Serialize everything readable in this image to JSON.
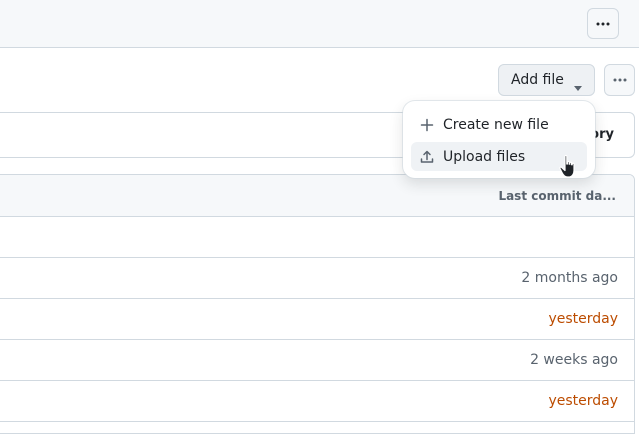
{
  "toolbar": {
    "more_icon": "kebab-horizontal-icon"
  },
  "file_actions": {
    "add_file_label": "Add file",
    "add_file_icon": "triangle-down-icon",
    "more_icon": "kebab-horizontal-icon"
  },
  "branch_bar": {
    "history_fragment": "ory"
  },
  "add_file_menu": {
    "items": [
      {
        "label": "Create new file",
        "icon": "plus-icon"
      },
      {
        "label": "Upload files",
        "icon": "upload-icon",
        "hovered": true
      }
    ]
  },
  "file_table": {
    "column_header": "Last commit da...",
    "rows": [
      {
        "date": ""
      },
      {
        "date": "2 months ago",
        "color": "#59636e"
      },
      {
        "date": "yesterday",
        "color": "#bc4c00"
      },
      {
        "date": "2 weeks ago",
        "color": "#59636e"
      },
      {
        "date": "yesterday",
        "color": "#bc4c00"
      }
    ]
  },
  "colors": {
    "accent_recent": "#bc4c00",
    "muted": "#59636e",
    "border": "#d1d9e0"
  }
}
